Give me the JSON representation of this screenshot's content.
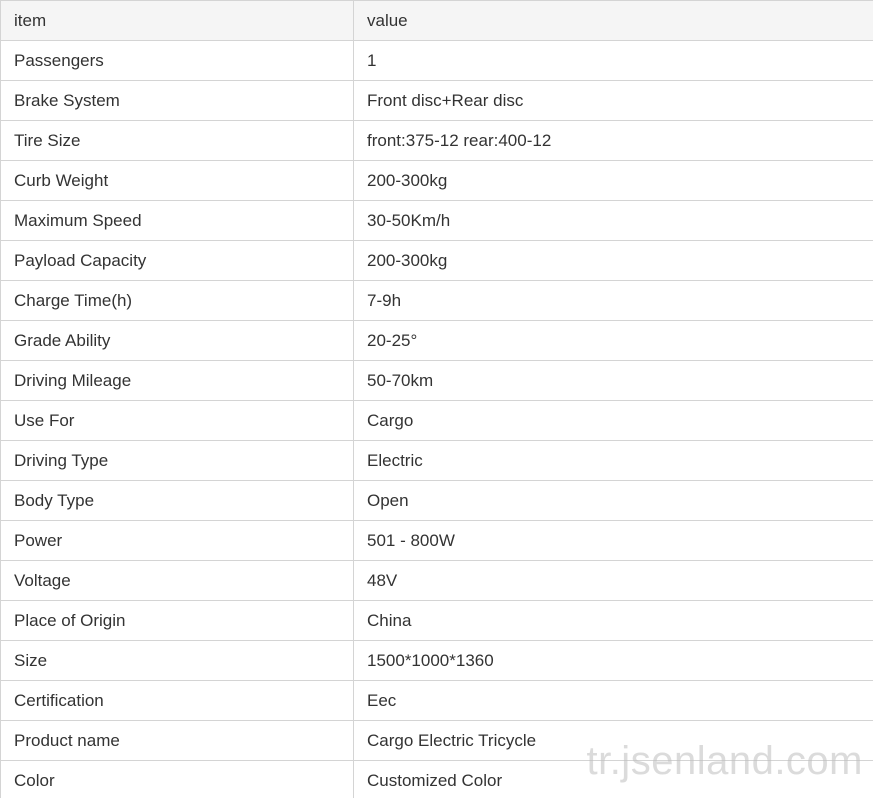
{
  "table": {
    "headers": [
      "item",
      "value"
    ],
    "rows": [
      [
        "Passengers",
        "1"
      ],
      [
        "Brake System",
        "Front disc+Rear disc"
      ],
      [
        "Tire Size",
        "front:375-12 rear:400-12"
      ],
      [
        "Curb Weight",
        "200-300kg"
      ],
      [
        "Maximum Speed",
        "30-50Km/h"
      ],
      [
        "Payload Capacity",
        "200-300kg"
      ],
      [
        "Charge Time(h)",
        "7-9h"
      ],
      [
        "Grade Ability",
        "20-25°"
      ],
      [
        "Driving Mileage",
        "50-70km"
      ],
      [
        "Use For",
        "Cargo"
      ],
      [
        "Driving Type",
        "Electric"
      ],
      [
        "Body Type",
        "Open"
      ],
      [
        "Power",
        "501 - 800W"
      ],
      [
        "Voltage",
        "48V"
      ],
      [
        "Place of Origin",
        "China"
      ],
      [
        "Size",
        "1500*1000*1360"
      ],
      [
        "Certification",
        "Eec"
      ],
      [
        "Product name",
        "Cargo Electric Tricycle"
      ],
      [
        "Color",
        "Customized Color"
      ]
    ]
  },
  "watermark": "tr.jsenland.com"
}
